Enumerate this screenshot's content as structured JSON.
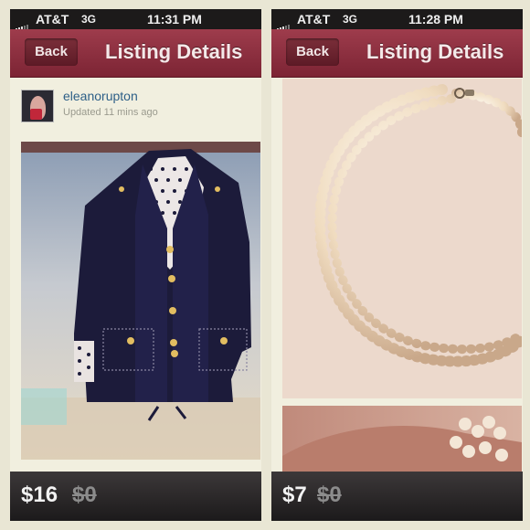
{
  "left": {
    "status": {
      "carrier": "AT&T",
      "network": "3G",
      "time": "11:31 PM"
    },
    "nav": {
      "back_label": "Back",
      "title": "Listing Details"
    },
    "seller": {
      "username": "eleanorupton",
      "updated": "Updated 11 mins ago"
    },
    "image_icon": "jacket-photo",
    "price": "$16",
    "original_price": "$0"
  },
  "right": {
    "status": {
      "carrier": "AT&T",
      "network": "3G",
      "time": "11:28 PM"
    },
    "nav": {
      "back_label": "Back",
      "title": "Listing Details"
    },
    "image_icon": "pearl-necklace-photo",
    "price": "$7",
    "original_price": "$0"
  },
  "colors": {
    "nav_bar": "#8b2d3d",
    "price_bar": "#2a2727",
    "link": "#2d5f87"
  }
}
